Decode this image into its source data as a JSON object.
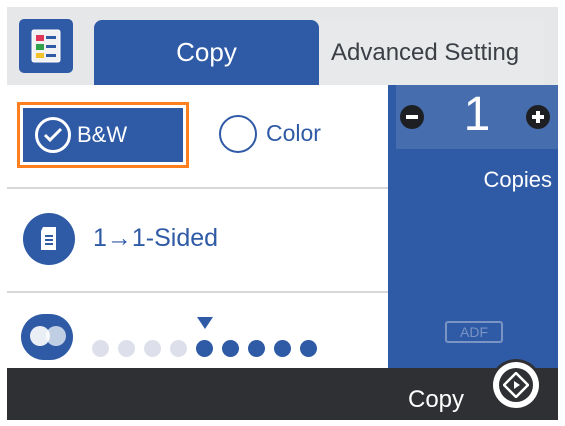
{
  "tabs": {
    "copy": "Copy",
    "advanced": "Advanced Setting"
  },
  "color_mode": {
    "bw_label": "B&W",
    "color_label": "Color",
    "selected": "B&W"
  },
  "sided": {
    "label": "1→1-Sided"
  },
  "density": {
    "levels": 9,
    "selected_index": 4
  },
  "copies": {
    "value": "1",
    "label": "Copies"
  },
  "adf_label": "ADF",
  "bottom": {
    "copy_label": "Copy"
  },
  "colors": {
    "accent": "#2e5aa6",
    "highlight": "#ff7f1f",
    "dark": "#2f3033"
  }
}
